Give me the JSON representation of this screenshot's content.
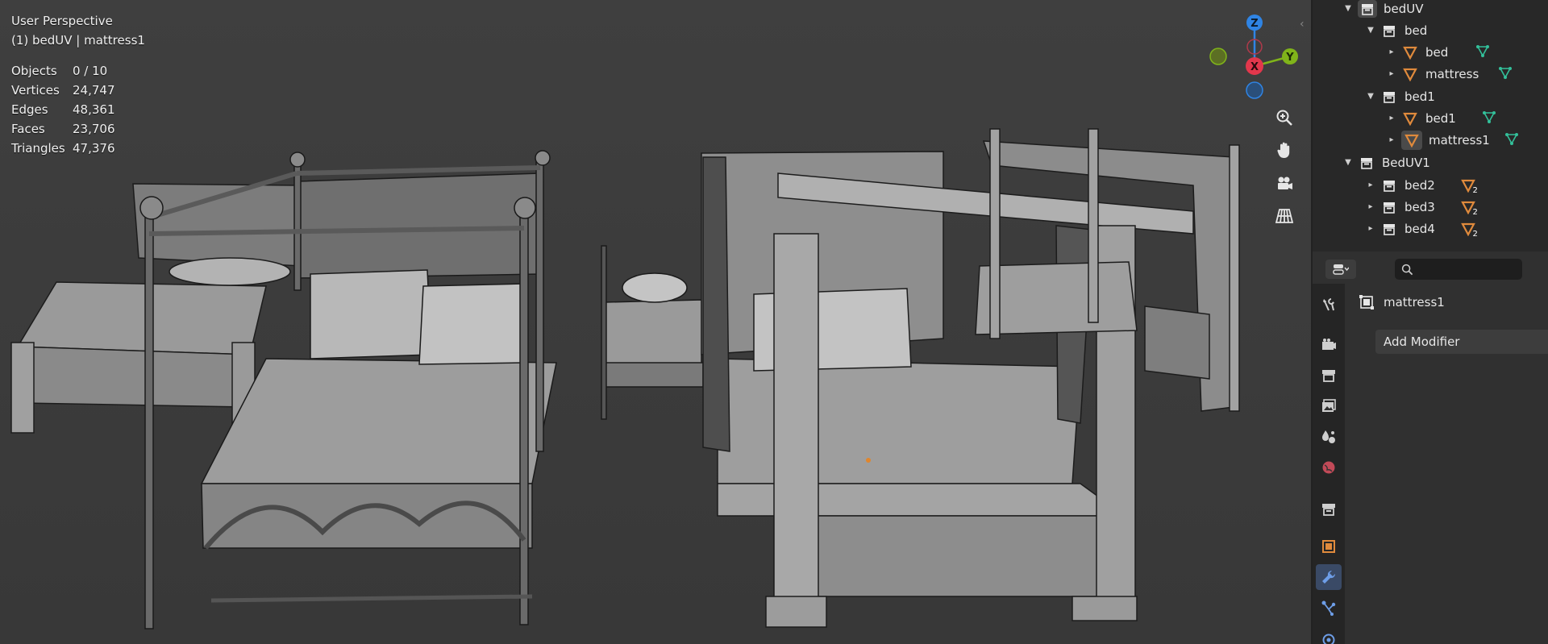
{
  "viewport": {
    "view_name": "User Perspective",
    "context": "(1) bedUV | mattress1",
    "stats": [
      {
        "label": "Objects",
        "value": "0 / 10"
      },
      {
        "label": "Vertices",
        "value": "24,747"
      },
      {
        "label": "Edges",
        "value": "48,361"
      },
      {
        "label": "Faces",
        "value": "23,706"
      },
      {
        "label": "Triangles",
        "value": "47,376"
      }
    ],
    "gizmo": {
      "z": "Z",
      "y": "Y",
      "x": "X"
    },
    "colors": {
      "x_axis": "#e2374c",
      "y_axis": "#80b41a",
      "z_axis": "#2f84e4",
      "background": "#3d3d3d"
    }
  },
  "outliner": {
    "rows": [
      {
        "label": "bedUV",
        "kind": "collection",
        "expanded": true
      },
      {
        "label": "bed",
        "kind": "collection",
        "expanded": true
      },
      {
        "label": "bed",
        "kind": "mesh-object"
      },
      {
        "label": "mattress",
        "kind": "mesh-object"
      },
      {
        "label": "bed1",
        "kind": "collection",
        "expanded": true
      },
      {
        "label": "bed1",
        "kind": "mesh-object"
      },
      {
        "label": "mattress1",
        "kind": "mesh-object",
        "active": true
      },
      {
        "label": "BedUV1",
        "kind": "collection",
        "expanded": true
      },
      {
        "label": "bed2",
        "kind": "collection",
        "badge": "2"
      },
      {
        "label": "bed3",
        "kind": "collection",
        "badge": "2"
      },
      {
        "label": "bed4",
        "kind": "collection",
        "badge": "2"
      }
    ]
  },
  "properties": {
    "search_value": "",
    "object_name": "mattress1",
    "add_modifier_label": "Add Modifier",
    "active_tab": "modifiers"
  }
}
